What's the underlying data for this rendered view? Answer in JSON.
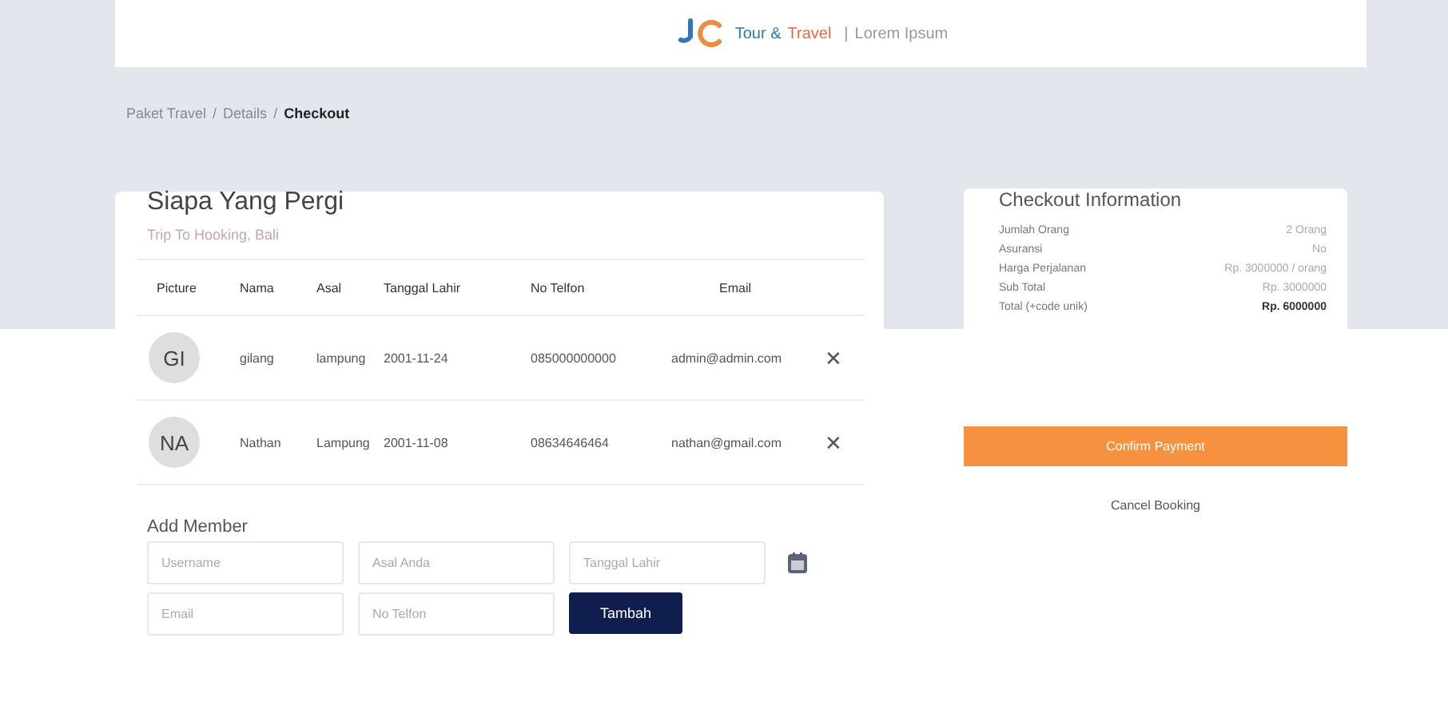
{
  "navbar": {
    "brand_primary": "Tour &",
    "brand_accent": "Travel",
    "divider": "|",
    "tagline": "Lorem Ipsum"
  },
  "breadcrumb": [
    {
      "label": "Paket Travel",
      "selected": false
    },
    {
      "label": "Details",
      "selected": false
    },
    {
      "label": "Checkout",
      "selected": true
    }
  ],
  "breadcrumb_separator": "/",
  "members_card": {
    "title": "Siapa Yang Pergi",
    "subtitle": "Trip To Hooking, Bali",
    "table": {
      "columns": [
        "Picture",
        "Nama",
        "Asal",
        "Tanggal Lahir",
        "No Telfon",
        "Email"
      ],
      "rows": [
        {
          "initials": "GI",
          "nama": "gilang",
          "asal": "lampung",
          "tanggal_lahir": "2001-11-24",
          "no_telfon": "085000000000",
          "email": "admin@admin.com",
          "remove": "✕"
        },
        {
          "initials": "NA",
          "nama": "Nathan",
          "asal": "Lampung",
          "tanggal_lahir": "2001-11-08",
          "no_telfon": "08634646464",
          "email": "nathan@gmail.com",
          "remove": "✕"
        }
      ]
    },
    "add_member": {
      "title": "Add Member",
      "fields": [
        {
          "placeholder": "Username"
        },
        {
          "placeholder": "Asal Anda"
        },
        {
          "placeholder": "Tanggal Lahir",
          "kind": "date"
        },
        {
          "placeholder": "Email"
        },
        {
          "placeholder": "No Telfon"
        }
      ],
      "submit": "Tambah"
    }
  },
  "checkout_info": {
    "title": "Checkout Information",
    "rows": [
      {
        "label": "Jumlah Orang",
        "value": "2 Orang",
        "emphasis": false
      },
      {
        "label": "Asuransi",
        "value": "No",
        "emphasis": false
      },
      {
        "label": "Harga Perjalanan",
        "value": "Rp. 3000000 / orang",
        "emphasis": false
      },
      {
        "label": "Sub Total",
        "value": "Rp. 3000000",
        "emphasis": false
      },
      {
        "label": "Total (+code unik)",
        "value": "Rp. 6000000",
        "emphasis": true
      }
    ]
  },
  "confirm_button": "Confirm Payment",
  "cancel_link": "Cancel Booking"
}
